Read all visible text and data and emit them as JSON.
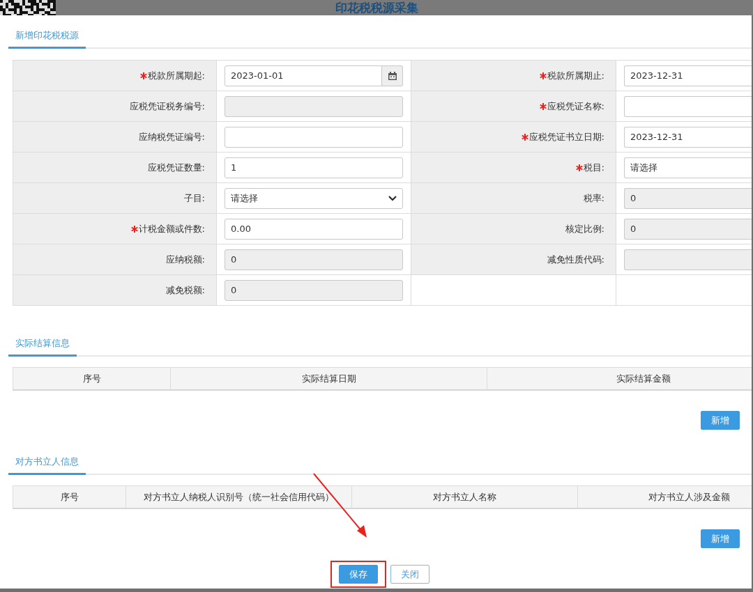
{
  "window": {
    "title": "印花税税源采集"
  },
  "tabs": [
    {
      "label": "新增印花税税源",
      "selected": true
    }
  ],
  "form": {
    "rows": [
      {
        "fields": [
          {
            "label": "税款所属期起:",
            "required": true,
            "kind": "date",
            "value": "2023-01-01",
            "disabled": false
          },
          {
            "label": "税款所属期止:",
            "required": true,
            "kind": "text",
            "value": "2023-12-31",
            "disabled": false
          }
        ]
      },
      {
        "fields": [
          {
            "label": "应税凭证税务编号:",
            "required": false,
            "kind": "text",
            "disabled": true
          },
          {
            "label": "应税凭证名称:",
            "required": true,
            "kind": "text",
            "disabled": false
          }
        ]
      },
      {
        "fields": [
          {
            "label": "应纳税凭证编号:",
            "required": false,
            "kind": "text",
            "disabled": false
          },
          {
            "label": "应税凭证书立日期:",
            "required": true,
            "kind": "text",
            "value": "2023-12-31",
            "disabled": false
          }
        ]
      },
      {
        "fields": [
          {
            "label": "应税凭证数量:",
            "required": false,
            "kind": "text",
            "value": "1",
            "disabled": false
          },
          {
            "label": "税目:",
            "required": true,
            "kind": "text",
            "value": "请选择",
            "disabled": false
          }
        ]
      },
      {
        "fields": [
          {
            "label": "子目:",
            "required": false,
            "kind": "select",
            "value": "请选择",
            "disabled": false
          },
          {
            "label": "税率:",
            "required": false,
            "kind": "text",
            "value": "0",
            "disabled": true
          }
        ]
      },
      {
        "fields": [
          {
            "label": "计税金额或件数:",
            "required": true,
            "kind": "text",
            "value": "0.00",
            "disabled": false
          },
          {
            "label": "核定比例:",
            "required": false,
            "kind": "text",
            "value": "0",
            "disabled": true
          }
        ]
      },
      {
        "fields": [
          {
            "label": "应纳税额:",
            "required": false,
            "kind": "text",
            "value": "0",
            "disabled": true
          },
          {
            "label": "减免性质代码:",
            "required": false,
            "kind": "text",
            "disabled": true
          }
        ]
      },
      {
        "fields": [
          {
            "label": "减免税额:",
            "required": false,
            "kind": "text",
            "value": "0",
            "disabled": true
          }
        ]
      }
    ]
  },
  "sections": [
    {
      "title": "实际结算信息",
      "selected": true,
      "kind": "settle",
      "columns": [
        "序号",
        "实际结算日期",
        "实际结算金额"
      ],
      "add_button": "新增"
    },
    {
      "title": "对方书立人信息",
      "selected": true,
      "kind": "party",
      "columns": [
        "序号",
        "对方书立人纳税人识别号（统一社会信用代码）",
        "对方书立人名称",
        "对方书立人涉及金额"
      ],
      "add_button": "新增"
    }
  ],
  "footer_buttons": [
    {
      "label": "保存",
      "kind": "primary",
      "highlighted": true
    },
    {
      "label": "关闭",
      "kind": "secondary",
      "highlighted": false
    }
  ]
}
